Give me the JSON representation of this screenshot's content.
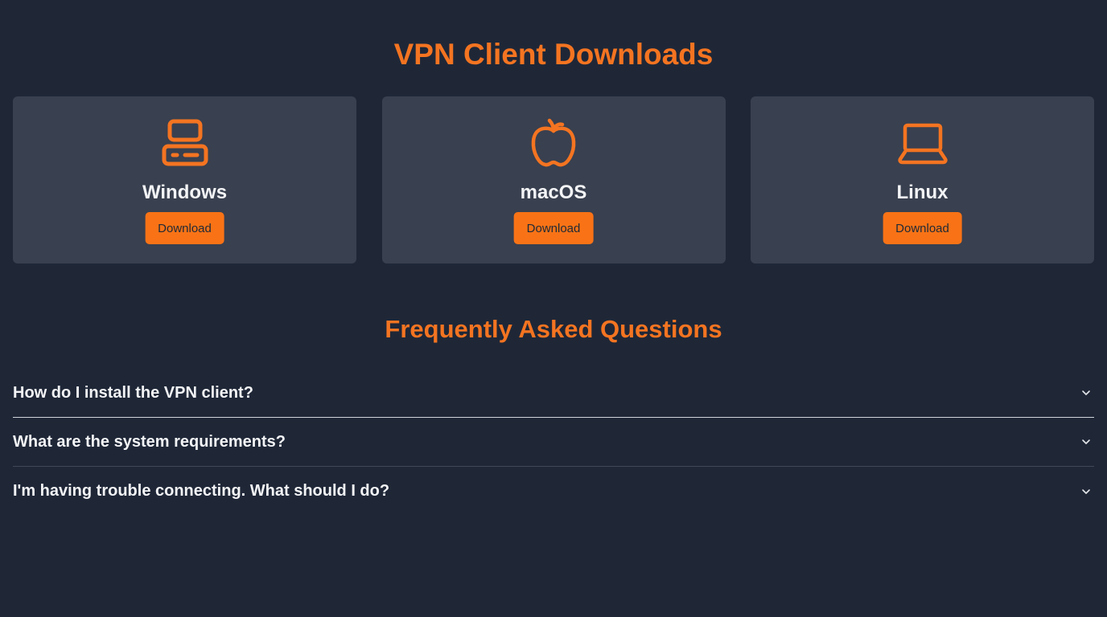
{
  "header": {
    "title": "VPN Client Downloads"
  },
  "theme": {
    "background": "#1f2737",
    "card_background": "#39404f",
    "accent": "#f97316",
    "heading_color": "#f47421",
    "text": "#f3f4f6"
  },
  "platforms": [
    {
      "name": "Windows",
      "icon": "desktop-computer-icon",
      "button_label": "Download"
    },
    {
      "name": "macOS",
      "icon": "apple-icon",
      "button_label": "Download"
    },
    {
      "name": "Linux",
      "icon": "laptop-icon",
      "button_label": "Download"
    }
  ],
  "faq": {
    "title": "Frequently Asked Questions",
    "items": [
      {
        "question": "How do I install the VPN client?",
        "icon": "chevron-down-icon"
      },
      {
        "question": "What are the system requirements?",
        "icon": "chevron-down-icon"
      },
      {
        "question": "I'm having trouble connecting. What should I do?",
        "icon": "chevron-down-icon"
      }
    ]
  }
}
